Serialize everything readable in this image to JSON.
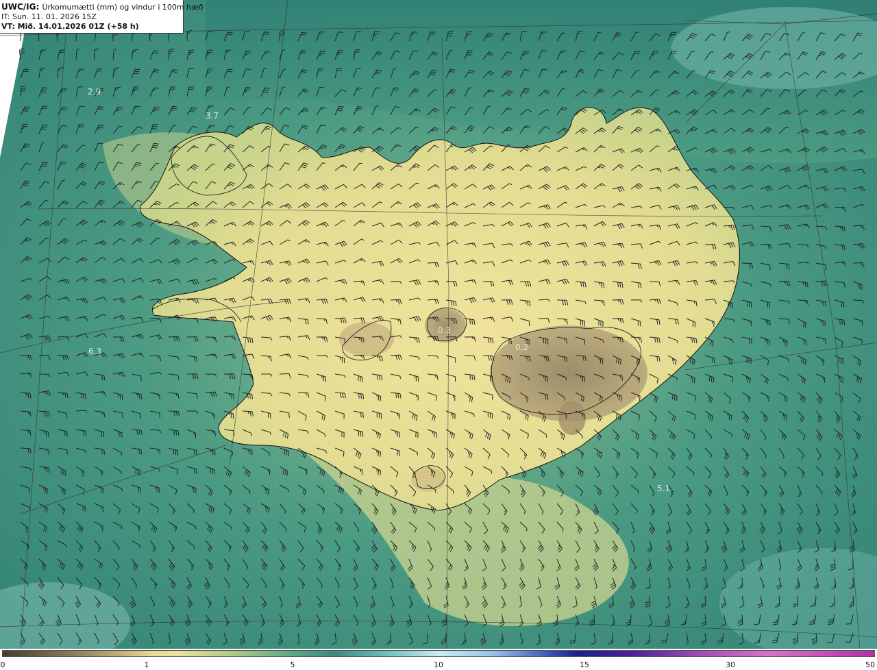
{
  "header": {
    "product": "UWC/IG:",
    "description": "Úrkomumætti (mm) og vindur i 100m hæð",
    "issue_time": "IT: Sun. 11. 01. 2026 15Z",
    "valid_time": "VT: Mið. 14.01.2026 01Z (+58 h)"
  },
  "map": {
    "value_labels": [
      {
        "id": "v1",
        "text": "2.9"
      },
      {
        "id": "v2",
        "text": "3.7"
      },
      {
        "id": "v3",
        "text": "0.3"
      },
      {
        "id": "v4",
        "text": "0.2"
      },
      {
        "id": "v5",
        "text": "6.3"
      },
      {
        "id": "v6",
        "text": "5.1"
      }
    ],
    "colors": {
      "ocean_deep": "#2f7f74",
      "ocean_light": "#74b9ad",
      "land_low": "#e8df94",
      "land_dry": "#9c8c67",
      "coastline": "#111111",
      "wind_barb": "#222222"
    }
  },
  "colorbar": {
    "ticks": [
      "0",
      "1",
      "5",
      "10",
      "15",
      "30",
      "50"
    ]
  }
}
